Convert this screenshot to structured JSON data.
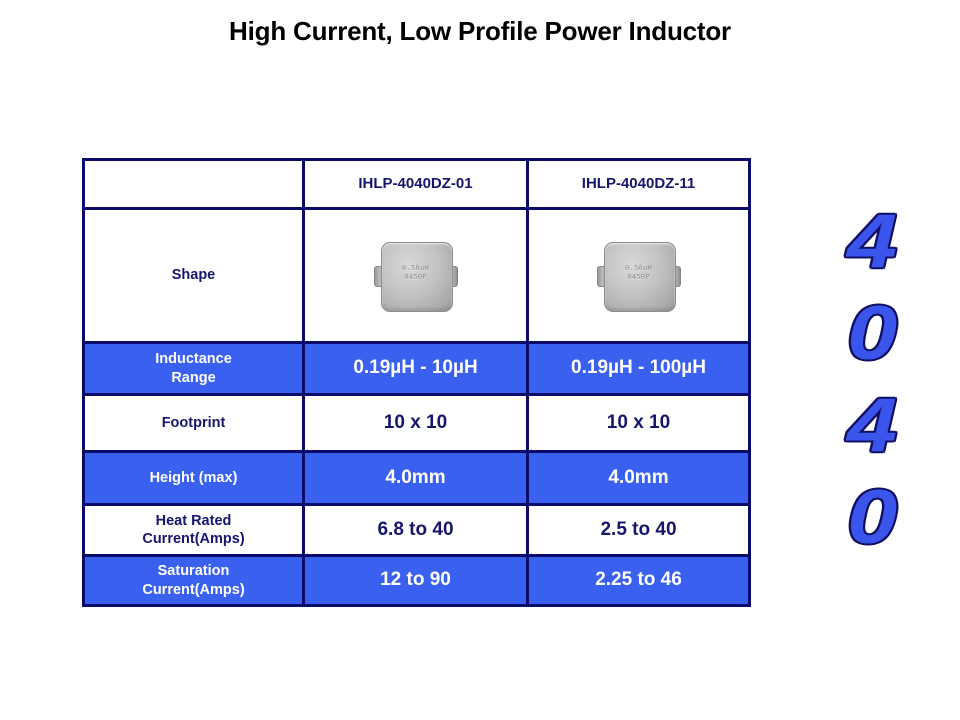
{
  "slide": {
    "title": "High Current, Low Profile Power Inductor"
  },
  "table": {
    "corner_label": "",
    "columns": [
      {
        "header": "IHLP-4040DZ-01"
      },
      {
        "header": "IHLP-4040DZ-11"
      }
    ],
    "rows": [
      {
        "label": "Shape",
        "type": "image",
        "values": [
          "inductor-photo",
          "inductor-photo"
        ]
      },
      {
        "label": "Inductance\nRange",
        "label_line1": "Inductance",
        "label_line2": "Range",
        "type": "text",
        "values": [
          "0.19µH - 10µH",
          "0.19µH - 100µH"
        ]
      },
      {
        "label": "Footprint",
        "label_line1": "Footprint",
        "label_line2": "",
        "type": "text",
        "values": [
          "10 x 10",
          "10 x 10"
        ]
      },
      {
        "label": "Height (max)",
        "label_line1": "Height (max)",
        "label_line2": "",
        "type": "text",
        "values": [
          "4.0mm",
          "4.0mm"
        ]
      },
      {
        "label": "Heat Rated Current(Amps)",
        "label_line1": "Heat Rated",
        "label_line2": "Current(Amps)",
        "type": "text",
        "values": [
          "6.8 to 40",
          "2.5 to 40"
        ]
      },
      {
        "label": "Saturation Current(Amps)",
        "label_line1": "Saturation",
        "label_line2": "Current(Amps)",
        "type": "text",
        "values": [
          "12 to 90",
          "2.25 to 46"
        ]
      }
    ]
  },
  "part_image": {
    "marking_line1": "0.56uH",
    "marking_line2": "0450P"
  },
  "decoration": {
    "digits": [
      "4",
      "0",
      "4",
      "0"
    ],
    "fill_color": "#3b55ec",
    "outline_color": "#101060"
  },
  "colors": {
    "band_blue": "#3a60f0",
    "border_navy": "#0b0b6b",
    "text_navy": "#16166e",
    "text_white": "#ffffff",
    "page_background": "#ffffff"
  }
}
